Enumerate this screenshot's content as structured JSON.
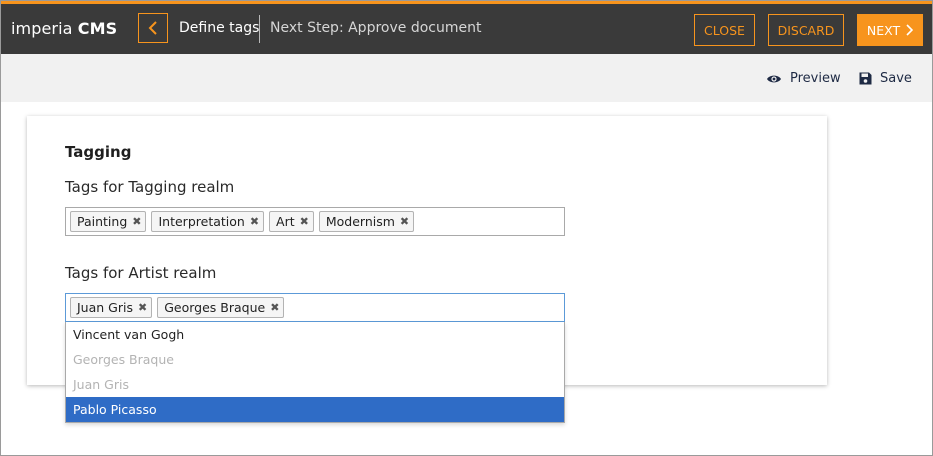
{
  "app": {
    "brand_light": "imperia",
    "brand_strong": "CMS"
  },
  "header": {
    "back_icon": "chevron-left-icon",
    "step_title": "Define tags",
    "next_step": "Next Step: Approve document",
    "close_label": "CLOSE",
    "discard_label": "DISCARD",
    "next_label": "NEXT"
  },
  "toolbar": {
    "preview_label": "Preview",
    "preview_icon": "eye-icon",
    "save_label": "Save",
    "save_icon": "floppy-disk-icon"
  },
  "form": {
    "section_title": "Tagging",
    "fields": [
      {
        "label": "Tags for Tagging realm",
        "tags": [
          "Painting",
          "Interpretation",
          "Art",
          "Modernism"
        ]
      },
      {
        "label": "Tags for Artist realm",
        "tags": [
          "Juan Gris",
          "Georges Braque"
        ]
      }
    ]
  },
  "dropdown": {
    "options": [
      {
        "label": "Vincent van Gogh",
        "state": "normal"
      },
      {
        "label": "Georges Braque",
        "state": "disabled"
      },
      {
        "label": "Juan Gris",
        "state": "disabled"
      },
      {
        "label": "Pablo Picasso",
        "state": "highlighted"
      }
    ]
  },
  "colors": {
    "accent": "#f7941d",
    "topbar_bg": "#3a3a3a",
    "subbar_bg": "#f1f1f1",
    "highlight": "#2f6cc6"
  }
}
